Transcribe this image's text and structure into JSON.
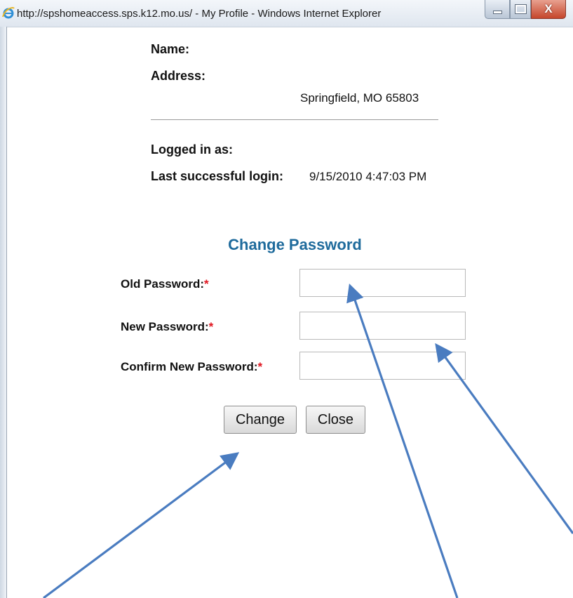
{
  "window": {
    "title": "http://spshomeaccess.sps.k12.mo.us/ - My Profile - Windows Internet Explorer",
    "close_glyph": "X"
  },
  "profile": {
    "name_label": "Name:",
    "address_label": "Address:",
    "address_line": "Springfield, MO 65803",
    "logged_in_label": "Logged in as:",
    "last_login_label": "Last successful login:",
    "last_login_value": "9/15/2010 4:47:03 PM"
  },
  "change_password": {
    "title": "Change Password",
    "required_marker": "*",
    "old_label": "Old Password:",
    "new_label": "New Password:",
    "confirm_label": "Confirm New Password:",
    "old_value": "",
    "new_value": "",
    "confirm_value": "",
    "change_button": "Change",
    "close_button": "Close"
  },
  "annotation_color": "#4a7cc0",
  "icons": [
    "ie-logo-icon",
    "minimize-icon",
    "maximize-icon",
    "close-icon",
    "annotation-arrow"
  ]
}
